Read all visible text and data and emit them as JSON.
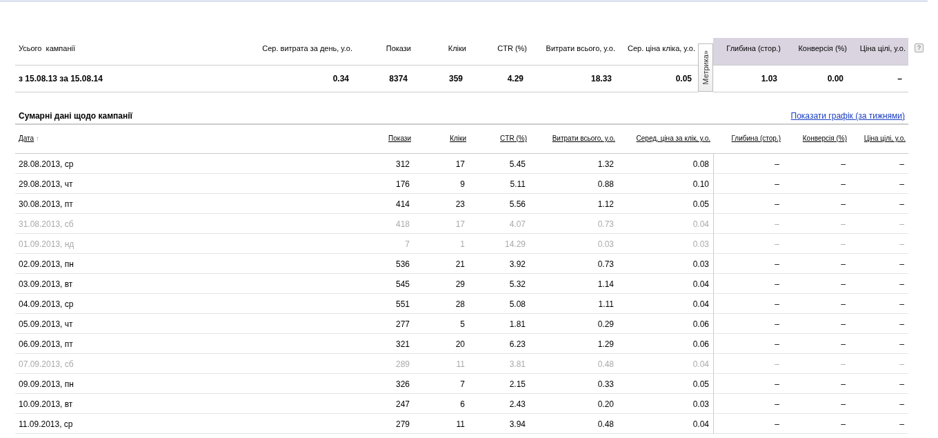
{
  "totals": {
    "columns": [
      {
        "label": "Усього  кампанії"
      },
      {
        "label": "Сер. витрата за день, у.о."
      },
      {
        "label": "Покази"
      },
      {
        "label": "Кліки"
      },
      {
        "label": "CTR (%)"
      },
      {
        "label": "Витрати всього, у.о."
      },
      {
        "label": "Сер. ціна кліка, у.о."
      },
      {
        "label": "Глибина (стор.)",
        "metrika": true
      },
      {
        "label": "Конверсія (%)",
        "metrika": true
      },
      {
        "label": "Ціна цілі, у.о.",
        "metrika": true
      }
    ],
    "metrika_tab": "Метрика»",
    "help": "?",
    "row": [
      "з 15.08.13 за 15.08.14",
      "0.34",
      "8374",
      "359",
      "4.29",
      "18.33",
      "0.05",
      "1.03",
      "0.00",
      "–"
    ]
  },
  "summary": {
    "title": "Сумарні дані щодо кампанії",
    "chart_link": "Показати графік (за тижнями)",
    "columns": [
      {
        "label": "Дата",
        "sort_arrow": "↑"
      },
      {
        "label": "Покази"
      },
      {
        "label": "Кліки"
      },
      {
        "label": "CTR (%)"
      },
      {
        "label": "Витрати всього, у.о."
      },
      {
        "label": "Серед. ціна за клік, у.о."
      },
      {
        "label": "Глибина (стор.)"
      },
      {
        "label": "Конверсія (%)"
      },
      {
        "label": "Ціна цілі, у.о."
      }
    ],
    "rows": [
      {
        "weekend": false,
        "cells": [
          "28.08.2013, ср",
          "312",
          "17",
          "5.45",
          "1.32",
          "0.08",
          "–",
          "–",
          "–"
        ]
      },
      {
        "weekend": false,
        "cells": [
          "29.08.2013, чт",
          "176",
          "9",
          "5.11",
          "0.88",
          "0.10",
          "–",
          "–",
          "–"
        ]
      },
      {
        "weekend": false,
        "cells": [
          "30.08.2013, пт",
          "414",
          "23",
          "5.56",
          "1.12",
          "0.05",
          "–",
          "–",
          "–"
        ]
      },
      {
        "weekend": true,
        "cells": [
          "31.08.2013, сб",
          "418",
          "17",
          "4.07",
          "0.73",
          "0.04",
          "–",
          "–",
          "–"
        ]
      },
      {
        "weekend": true,
        "cells": [
          "01.09.2013, нд",
          "7",
          "1",
          "14.29",
          "0.03",
          "0.03",
          "–",
          "–",
          "–"
        ]
      },
      {
        "weekend": false,
        "cells": [
          "02.09.2013, пн",
          "536",
          "21",
          "3.92",
          "0.73",
          "0.03",
          "–",
          "–",
          "–"
        ]
      },
      {
        "weekend": false,
        "cells": [
          "03.09.2013, вт",
          "545",
          "29",
          "5.32",
          "1.14",
          "0.04",
          "–",
          "–",
          "–"
        ]
      },
      {
        "weekend": false,
        "cells": [
          "04.09.2013, ср",
          "551",
          "28",
          "5.08",
          "1.11",
          "0.04",
          "–",
          "–",
          "–"
        ]
      },
      {
        "weekend": false,
        "cells": [
          "05.09.2013, чт",
          "277",
          "5",
          "1.81",
          "0.29",
          "0.06",
          "–",
          "–",
          "–"
        ]
      },
      {
        "weekend": false,
        "cells": [
          "06.09.2013, пт",
          "321",
          "20",
          "6.23",
          "1.29",
          "0.06",
          "–",
          "–",
          "–"
        ]
      },
      {
        "weekend": true,
        "cells": [
          "07.09.2013, сб",
          "289",
          "11",
          "3.81",
          "0.48",
          "0.04",
          "–",
          "–",
          "–"
        ]
      },
      {
        "weekend": false,
        "cells": [
          "09.09.2013, пн",
          "326",
          "7",
          "2.15",
          "0.33",
          "0.05",
          "–",
          "–",
          "–"
        ]
      },
      {
        "weekend": false,
        "cells": [
          "10.09.2013, вт",
          "247",
          "6",
          "2.43",
          "0.20",
          "0.03",
          "–",
          "–",
          "–"
        ]
      },
      {
        "weekend": false,
        "cells": [
          "11.09.2013, ср",
          "279",
          "11",
          "3.94",
          "0.48",
          "0.04",
          "–",
          "–",
          "–"
        ]
      }
    ]
  }
}
